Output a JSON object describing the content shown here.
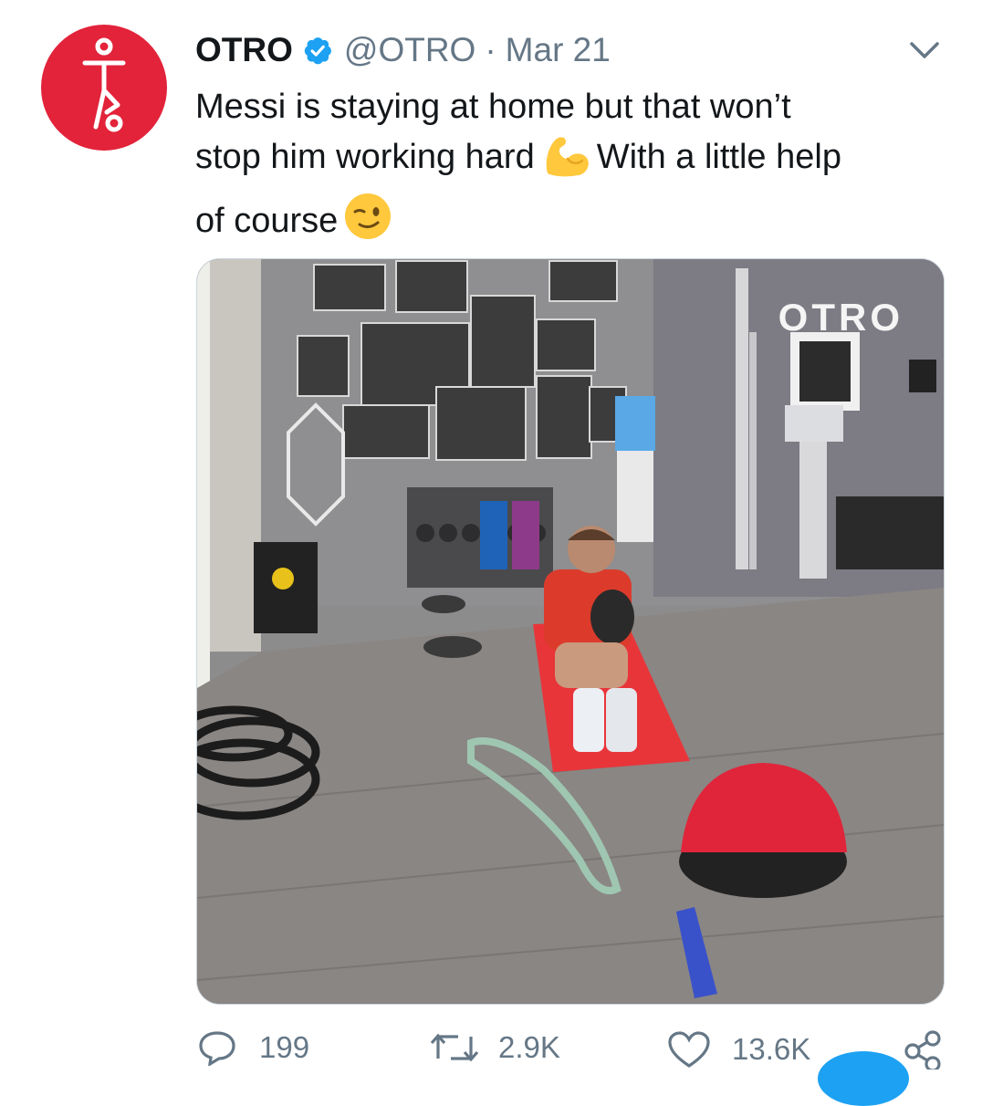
{
  "tweet": {
    "author_name": "OTRO",
    "handle": "@OTRO",
    "separator": "·",
    "date": "Mar 21",
    "text_line1": "Messi is staying at home but that won’t",
    "text_line2a": "stop him working hard",
    "text_line2b": "With a little help",
    "text_line3": "of course",
    "emoji_1": "flexed-biceps",
    "emoji_2": "winking-face"
  },
  "media": {
    "watermark": "OTRO",
    "description_icon": "video-thumbnail"
  },
  "actions": {
    "reply_count": "199",
    "retweet_count": "2.9K",
    "like_count": "13.6K"
  },
  "colors": {
    "brand_red": "#e2233a",
    "verified_blue": "#1da1f2",
    "muted_gray": "#657786",
    "text": "#14171a"
  }
}
